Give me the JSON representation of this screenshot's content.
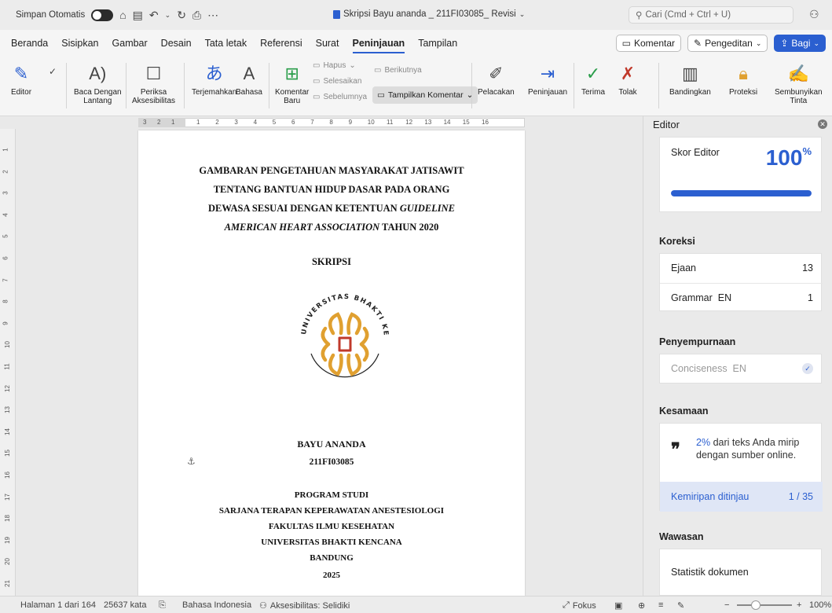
{
  "titlebar": {
    "autosave_label": "Simpan Otomatis",
    "doc_title": "Skripsi Bayu ananda _ 211FI03085_ Revisi",
    "search_placeholder": "Cari (Cmd + Ctrl + U)"
  },
  "menu": {
    "tabs": [
      "Beranda",
      "Sisipkan",
      "Gambar",
      "Desain",
      "Tata letak",
      "Referensi",
      "Surat",
      "Peninjauan",
      "Tampilan"
    ],
    "active_tab": "Peninjauan",
    "comment_label": "Komentar",
    "editing_label": "Pengeditan",
    "share_label": "Bagi"
  },
  "ribbon": {
    "editor": "Editor",
    "read_aloud": [
      "Baca Dengan",
      "Lantang"
    ],
    "accessibility": [
      "Periksa",
      "Aksesibilitas"
    ],
    "translate": "Terjemahkan",
    "language": "Bahasa",
    "new_comment": [
      "Komentar",
      "Baru"
    ],
    "delete": "Hapus",
    "resolve": "Selesaikan",
    "previous": "Sebelumnya",
    "next": "Berikutnya",
    "show_comments": "Tampilkan Komentar",
    "tracking": "Pelacakan",
    "reviewing": "Peninjauan",
    "accept": "Terima",
    "reject": "Tolak",
    "compare": "Bandingkan",
    "protect": "Proteksi",
    "hide_ink": [
      "Sembunyikan",
      "Tinta"
    ]
  },
  "ruler": {
    "left_numbers": [
      "3",
      "2",
      "1"
    ],
    "numbers": [
      "1",
      "2",
      "3",
      "4",
      "5",
      "6",
      "7",
      "8",
      "9",
      "10",
      "11",
      "12",
      "13",
      "14",
      "15",
      "16"
    ],
    "vertical_numbers": [
      "1",
      "2",
      "3",
      "4",
      "5",
      "6",
      "7",
      "8",
      "9",
      "10",
      "11",
      "12",
      "13",
      "14",
      "15",
      "16",
      "17",
      "18",
      "19",
      "20",
      "21"
    ]
  },
  "document": {
    "title_lines": [
      "GAMBARAN PENGETAHUAN MASYARAKAT JATISAWIT",
      "TENTANG BANTUAN HIDUP DASAR PADA ORANG",
      "DEWASA SESUAI DENGAN KETENTUAN",
      "GUIDELINE",
      "AMERICAN HEART ASSOCIATION",
      "TAHUN 2020"
    ],
    "type": "SKRIPSI",
    "logo_text": "UNIVERSITAS BHAKTI KENCANA",
    "author": "BAYU ANANDA",
    "student_id": "211FI03085",
    "program_lines": [
      "PROGRAM STUDI",
      "SARJANA TERAPAN KEPERAWATAN ANESTESIOLOGI",
      "FAKULTAS ILMU KESEHATAN",
      "UNIVERSITAS BHAKTI KENCANA",
      "BANDUNG",
      "2025"
    ]
  },
  "editor_pane": {
    "title": "Editor",
    "score_label": "Skor Editor",
    "score_value": "100",
    "score_unit": "%",
    "score_fraction": 1.0,
    "corrections_title": "Koreksi",
    "spelling_label": "Ejaan",
    "spelling_count": "13",
    "grammar_label": "Grammar",
    "grammar_lang": "EN",
    "grammar_count": "1",
    "refinement_title": "Penyempurnaan",
    "conciseness_label": "Conciseness",
    "conciseness_lang": "EN",
    "similarity_title": "Kesamaan",
    "similarity_percent": "2%",
    "similarity_text": "dari teks Anda mirip dengan sumber online.",
    "similarity_reviewed_label": "Kemiripan ditinjau",
    "similarity_reviewed_count": "1 / 35",
    "insights_title": "Wawasan",
    "doc_stats_label": "Statistik dokumen"
  },
  "status": {
    "page": "Halaman 1 dari 164",
    "words": "25637 kata",
    "language": "Bahasa Indonesia",
    "accessibility": "Aksesibilitas: Selidiki",
    "focus": "Fokus",
    "zoom": "100%"
  },
  "colors": {
    "accent": "#2b5fd0",
    "logo_orange": "#e0a030",
    "logo_red": "#c0392b"
  }
}
